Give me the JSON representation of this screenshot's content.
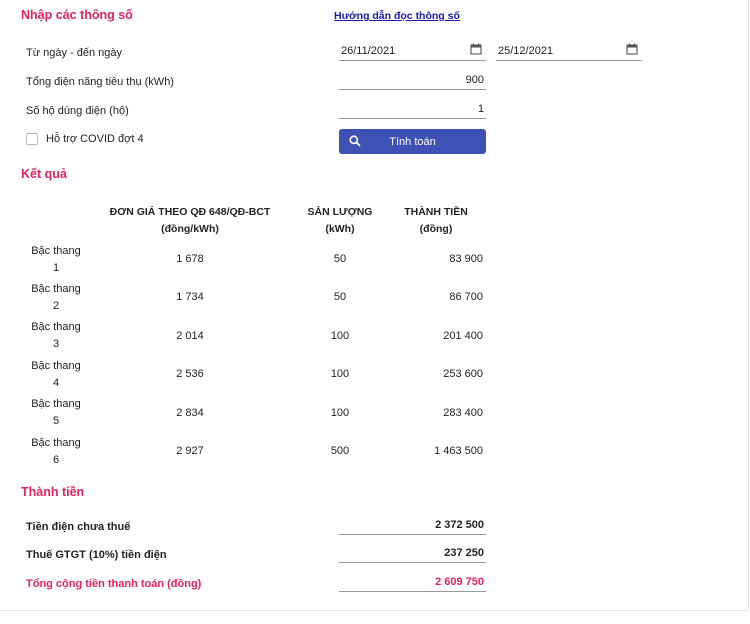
{
  "colors": {
    "accent": "#e0245e",
    "button": "#3f51b5",
    "link": "#1a1aa6"
  },
  "inputs_section": {
    "title": "Nhập các thông số",
    "guide_link": "Hướng dẫn đọc thông số",
    "date_range_label": "Từ ngày - đến ngày",
    "date_from": "26/11/2021",
    "date_to": "25/12/2021",
    "consumption_label": "Tổng điện năng tiêu thụ (kWh)",
    "consumption_value": "900",
    "households_label": "Số hộ dùng điện (hộ)",
    "households_value": "1",
    "covid_label": "Hỗ trợ COVID đợt 4",
    "covid_checked": false,
    "calculate_button": "Tính toán",
    "search_icon": "search-icon",
    "calendar_icon": "calendar-icon"
  },
  "results_section": {
    "title": "Kết quả",
    "headers": {
      "price_line1": "ĐƠN GIÁ THEO QĐ 648/QĐ-BCT",
      "price_line2": "(đồng/kWh)",
      "qty_line1": "SẢN LƯỢNG",
      "qty_line2": "(kWh)",
      "amount_line1": "THÀNH TIỀN",
      "amount_line2": "(đồng)"
    },
    "rows": [
      {
        "tier_word": "Bậc thang",
        "tier_num": "1",
        "price": "1 678",
        "qty": "50",
        "amount": "83 900"
      },
      {
        "tier_word": "Bậc thang",
        "tier_num": "2",
        "price": "1 734",
        "qty": "50",
        "amount": "86 700"
      },
      {
        "tier_word": "Bậc thang",
        "tier_num": "3",
        "price": "2 014",
        "qty": "100",
        "amount": "201 400"
      },
      {
        "tier_word": "Bậc thang",
        "tier_num": "4",
        "price": "2 536",
        "qty": "100",
        "amount": "253 600"
      },
      {
        "tier_word": "Bậc thang",
        "tier_num": "5",
        "price": "2 834",
        "qty": "100",
        "amount": "283 400"
      },
      {
        "tier_word": "Bậc thang",
        "tier_num": "6",
        "price": "2 927",
        "qty": "500",
        "amount": "1 463 500"
      }
    ]
  },
  "totals_section": {
    "title": "Thành tiền",
    "pre_tax_label": "Tiền điện chưa thuế",
    "pre_tax_value": "2 372 500",
    "vat_label": "Thuế GTGT (10%) tiền điện",
    "vat_value": "237 250",
    "grand_label": "Tổng cộng tiền thanh toán (đồng)",
    "grand_value": "2 609 750"
  }
}
